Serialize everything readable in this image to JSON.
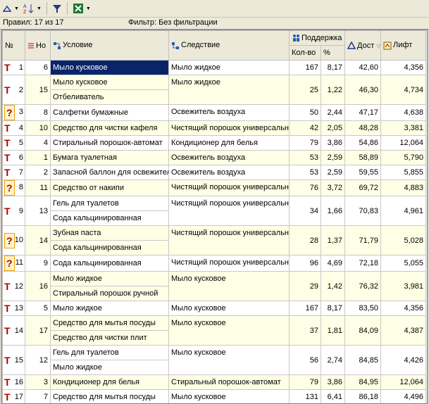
{
  "status": {
    "rules_text": "Правил: 17 из 17",
    "filter_text": "Фильтр: Без фильтрации"
  },
  "headers": {
    "no": "№",
    "rule_no": "Но",
    "condition": "Условие",
    "consequence": "Следствие",
    "support": "Поддержка",
    "count": "Кол-во",
    "percent": "%",
    "confidence": "Дост",
    "lift": "Лифт"
  },
  "rows": [
    {
      "n": "1",
      "type": "T",
      "num": "6",
      "cond": [
        "Мыло кусковое"
      ],
      "cons": "Мыло жидкое",
      "cnt": "167",
      "pct": "8,17",
      "conf": "42,60",
      "lift": "4,356",
      "selected": true
    },
    {
      "n": "2",
      "type": "T",
      "num": "15",
      "cond": [
        "Мыло кусковое",
        "Отбеливатель"
      ],
      "cons": "Мыло жидкое",
      "cnt": "25",
      "pct": "1,22",
      "conf": "46,30",
      "lift": "4,734"
    },
    {
      "n": "3",
      "type": "?",
      "num": "8",
      "cond": [
        "Салфетки бумажные"
      ],
      "cons": "Освежитель воздуха",
      "cnt": "50",
      "pct": "2,44",
      "conf": "47,17",
      "lift": "4,638"
    },
    {
      "n": "4",
      "type": "T",
      "num": "10",
      "cond": [
        "Средство для чистки кафеля"
      ],
      "cons": "Чистящий порошок универсальн",
      "cnt": "42",
      "pct": "2,05",
      "conf": "48,28",
      "lift": "3,381"
    },
    {
      "n": "5",
      "type": "T",
      "num": "4",
      "cond": [
        "Стиральный порошок-автомат"
      ],
      "cons": "Кондиционер для белья",
      "cnt": "79",
      "pct": "3,86",
      "conf": "54,86",
      "lift": "12,064"
    },
    {
      "n": "6",
      "type": "T",
      "num": "1",
      "cond": [
        "Бумага туалетная"
      ],
      "cons": "Освежитель воздуха",
      "cnt": "53",
      "pct": "2,59",
      "conf": "58,89",
      "lift": "5,790"
    },
    {
      "n": "7",
      "type": "T",
      "num": "2",
      "cond": [
        "Запасной баллон для освежител"
      ],
      "cons": "Освежитель воздуха",
      "cnt": "53",
      "pct": "2,59",
      "conf": "59,55",
      "lift": "5,855"
    },
    {
      "n": "8",
      "type": "?",
      "num": "11",
      "cond": [
        "Средство от накипи"
      ],
      "cons": "Чистящий порошок универсальн",
      "cnt": "76",
      "pct": "3,72",
      "conf": "69,72",
      "lift": "4,883"
    },
    {
      "n": "9",
      "type": "T",
      "num": "13",
      "cond": [
        "Гель для туалетов",
        "Сода кальцинированная"
      ],
      "cons": "Чистящий порошок универсальн",
      "cnt": "34",
      "pct": "1,66",
      "conf": "70,83",
      "lift": "4,961"
    },
    {
      "n": "10",
      "type": "?",
      "num": "14",
      "cond": [
        "Зубная паста",
        "Сода кальцинированная"
      ],
      "cons": "Чистящий порошок универсальн",
      "cnt": "28",
      "pct": "1,37",
      "conf": "71,79",
      "lift": "5,028"
    },
    {
      "n": "11",
      "type": "?",
      "num": "9",
      "cond": [
        "Сода кальцинированная"
      ],
      "cons": "Чистящий порошок универсальн",
      "cnt": "96",
      "pct": "4,69",
      "conf": "72,18",
      "lift": "5,055"
    },
    {
      "n": "12",
      "type": "T",
      "num": "16",
      "cond": [
        "Мыло жидкое",
        "Стиральный порошок ручной"
      ],
      "cons": "Мыло кусковое",
      "cnt": "29",
      "pct": "1,42",
      "conf": "76,32",
      "lift": "3,981"
    },
    {
      "n": "13",
      "type": "T",
      "num": "5",
      "cond": [
        "Мыло жидкое"
      ],
      "cons": "Мыло кусковое",
      "cnt": "167",
      "pct": "8,17",
      "conf": "83,50",
      "lift": "4,356"
    },
    {
      "n": "14",
      "type": "T",
      "num": "17",
      "cond": [
        "Средство для мытья посуды",
        "Средство для чистки плит"
      ],
      "cons": "Мыло кусковое",
      "cnt": "37",
      "pct": "1,81",
      "conf": "84,09",
      "lift": "4,387"
    },
    {
      "n": "15",
      "type": "T",
      "num": "12",
      "cond": [
        "Гель для туалетов",
        "Мыло жидкое"
      ],
      "cons": "Мыло кусковое",
      "cnt": "56",
      "pct": "2,74",
      "conf": "84,85",
      "lift": "4,426"
    },
    {
      "n": "16",
      "type": "T",
      "num": "3",
      "cond": [
        "Кондиционер для белья"
      ],
      "cons": "Стиральный порошок-автомат",
      "cnt": "79",
      "pct": "3,86",
      "conf": "84,95",
      "lift": "12,064"
    },
    {
      "n": "17",
      "type": "T",
      "num": "7",
      "cond": [
        "Средство для мытья посуды"
      ],
      "cons": "Мыло кусковое",
      "cnt": "131",
      "pct": "6,41",
      "conf": "86,18",
      "lift": "4,496"
    }
  ]
}
